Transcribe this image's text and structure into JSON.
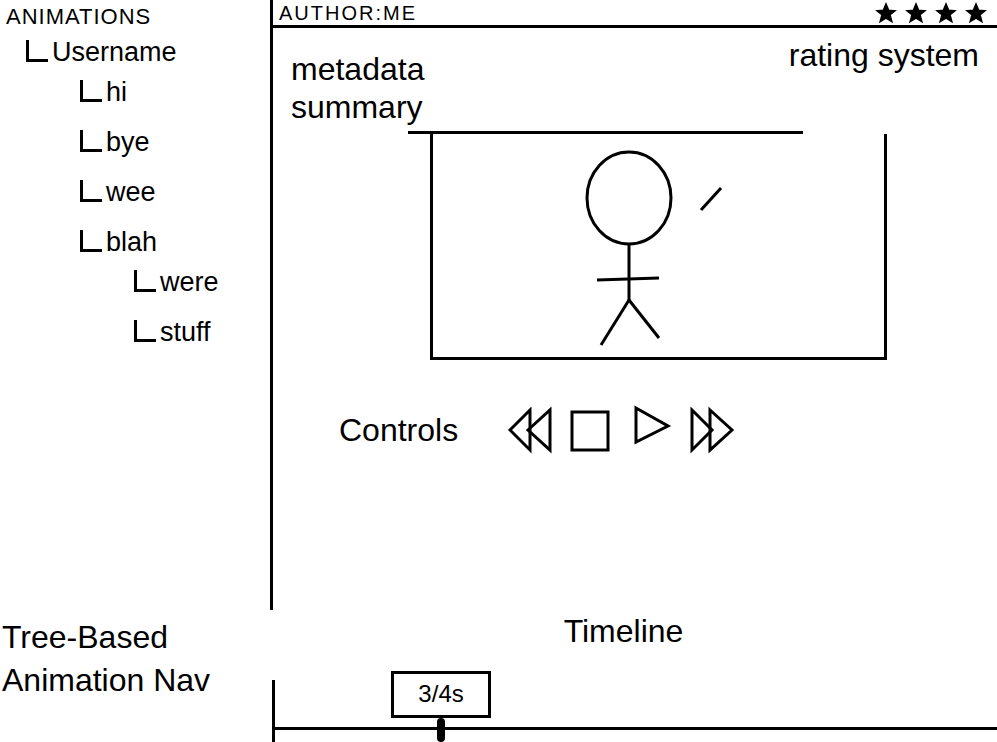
{
  "tree": {
    "title": "ANIMATIONS",
    "items": [
      {
        "label": "Username",
        "expanded": true,
        "children": [
          {
            "label": "hi"
          },
          {
            "label": "bye"
          },
          {
            "label": "wee"
          },
          {
            "label": "blah",
            "expanded": true,
            "children": [
              {
                "label": "were"
              },
              {
                "label": "stuff"
              }
            ]
          }
        ]
      }
    ]
  },
  "author": "AUTHOR:ME",
  "rating": {
    "label": "rating system",
    "stars": 4
  },
  "metadata": {
    "label": "metadata summary"
  },
  "controls": {
    "label": "Controls",
    "buttons": [
      {
        "kind": "rewind"
      },
      {
        "kind": "stop"
      },
      {
        "kind": "play"
      },
      {
        "kind": "fast-forward"
      }
    ]
  },
  "nav_label": "Tree-Based Animation Nav",
  "timeline": {
    "label": "Timeline",
    "marker": "3/4s",
    "level": 0.23
  }
}
